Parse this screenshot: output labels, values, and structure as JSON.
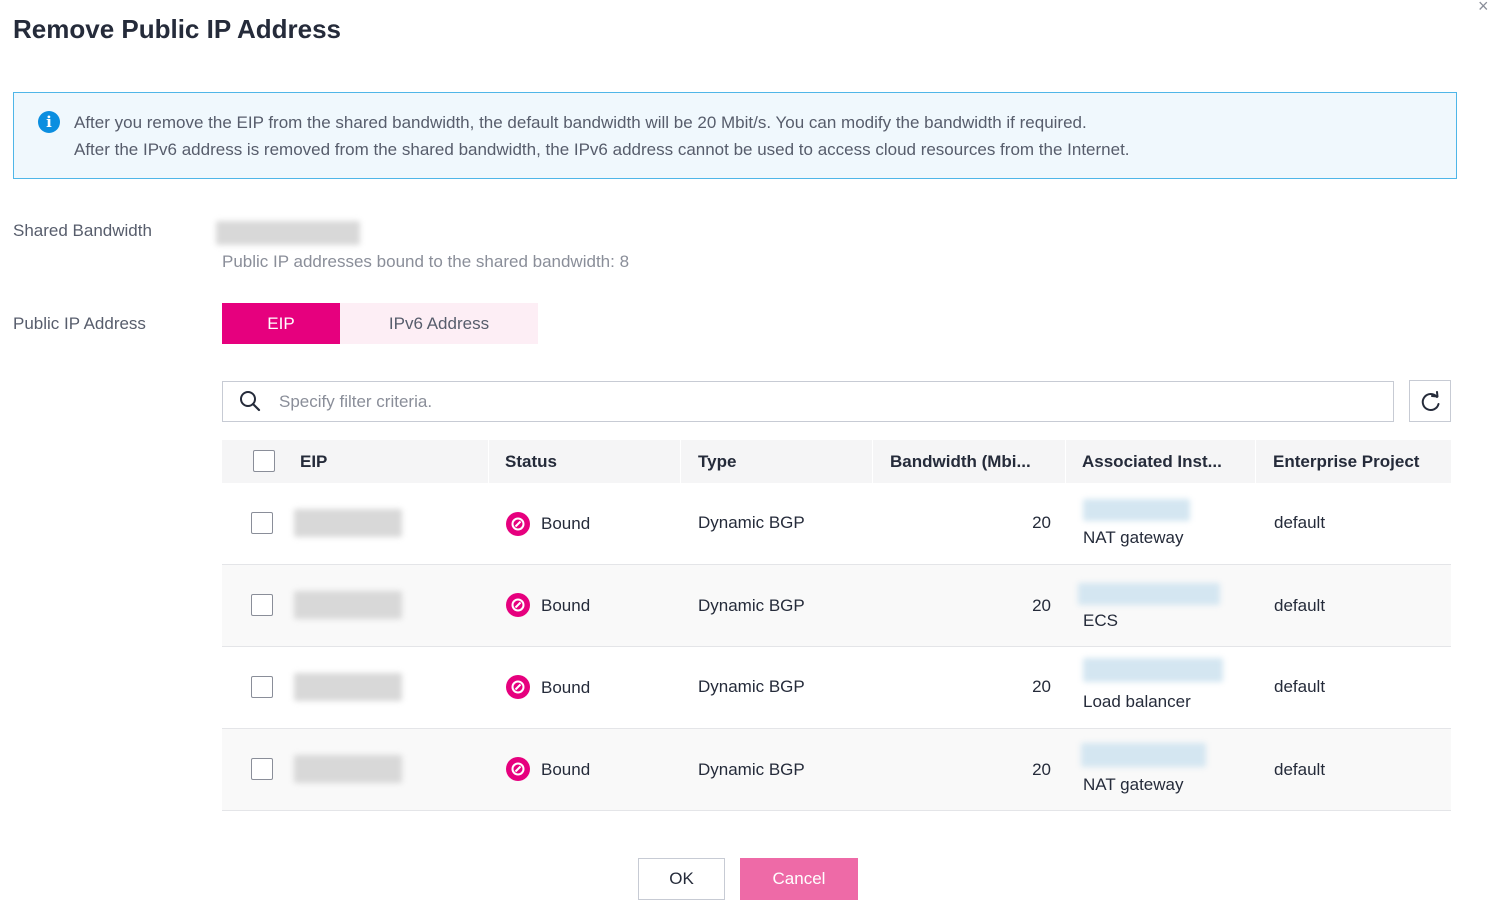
{
  "dialog": {
    "title": "Remove Public IP Address",
    "close_glyph": "×"
  },
  "alert": {
    "icon": "info-icon",
    "icon_glyph": "i",
    "line1": "After you remove the EIP from the shared bandwidth, the default bandwidth will be 20 Mbit/s. You can modify the bandwidth if required.",
    "line2": "After the IPv6 address is removed from the shared bandwidth, the IPv6 address cannot be used to access cloud resources from the Internet."
  },
  "shared_bandwidth": {
    "label": "Shared Bandwidth",
    "hint": "Public IP addresses bound to the shared bandwidth: 8"
  },
  "public_ip": {
    "label": "Public IP Address",
    "tabs": [
      {
        "label": "EIP",
        "active": true
      },
      {
        "label": "IPv6 Address",
        "active": false
      }
    ]
  },
  "search": {
    "placeholder": "Specify filter criteria.",
    "icon": "search-icon",
    "refresh_icon": "refresh-icon"
  },
  "table": {
    "columns": [
      "EIP",
      "Status",
      "Type",
      "Bandwidth (Mbi...",
      "Associated Inst...",
      "Enterprise Project"
    ],
    "rows": [
      {
        "status": "Bound",
        "type": "Dynamic BGP",
        "bandwidth": "20",
        "instance_type": "NAT gateway",
        "project": "default"
      },
      {
        "status": "Bound",
        "type": "Dynamic BGP",
        "bandwidth": "20",
        "instance_type": "ECS",
        "project": "default"
      },
      {
        "status": "Bound",
        "type": "Dynamic BGP",
        "bandwidth": "20",
        "instance_type": "Load balancer",
        "project": "default"
      },
      {
        "status": "Bound",
        "type": "Dynamic BGP",
        "bandwidth": "20",
        "instance_type": "NAT gateway",
        "project": "default"
      }
    ]
  },
  "buttons": {
    "ok": "OK",
    "cancel": "Cancel"
  },
  "colors": {
    "accent": "#e6007e",
    "accent_light": "#fdeef5",
    "cancel_bg": "#ee6aa7",
    "info_border": "#4fb6e8",
    "info_bg": "#f0f8fd"
  }
}
